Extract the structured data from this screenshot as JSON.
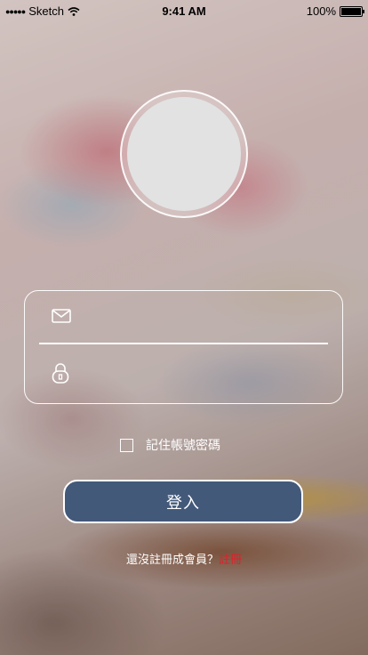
{
  "status_bar": {
    "carrier": "Sketch",
    "time": "9:41 AM",
    "battery": "100%",
    "battery_level": 1.0
  },
  "login_form": {
    "email_icon": "envelope-icon",
    "password_icon": "lock-icon",
    "email_value": "",
    "password_value": ""
  },
  "remember": {
    "label": "記住帳號密碼",
    "checked": false
  },
  "login_button": {
    "label": "登入"
  },
  "register": {
    "prompt": "還沒註冊成會員？",
    "link": "註冊"
  },
  "colors": {
    "button_bg": "#43597a",
    "link": "#e21f2a",
    "avatar_placeholder": "#e2e2e2"
  }
}
